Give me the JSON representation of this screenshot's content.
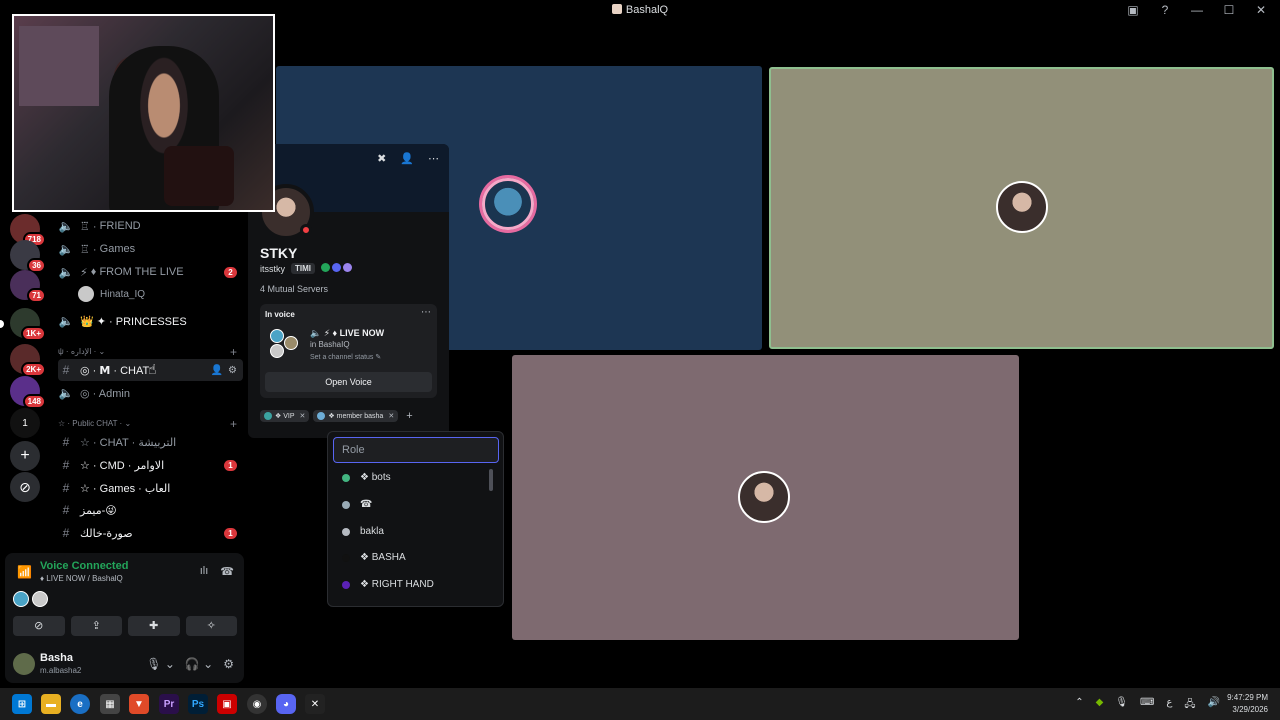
{
  "window": {
    "title": "BashalQ"
  },
  "rail": {
    "badges": [
      "718",
      "36",
      "71",
      "1K+",
      "2K+",
      "148"
    ],
    "number_item": "1",
    "add_label": "+",
    "discover_label": "⊘"
  },
  "channels": {
    "items": [
      {
        "label": "FRIEND",
        "prefix": "♖ ·"
      },
      {
        "label": "Games",
        "prefix": "♖ ·"
      },
      {
        "label": "♦ FROM THE LIVE",
        "prefix": "⚡",
        "badge": "2"
      },
      {
        "label": "✦ · PRINCESSES",
        "prefix": "👑"
      },
      {
        "label": "◎ · 𝗠 · CHAT",
        "prefix": ""
      },
      {
        "label": "◎ · Admin",
        "prefix": ""
      },
      {
        "label": "☆ · CHAT · التربيشة",
        "prefix": ""
      },
      {
        "label": "☆ · CMD · الاوامر",
        "prefix": "",
        "badge": "1"
      },
      {
        "label": "☆ · Games · العاب",
        "prefix": ""
      },
      {
        "label": "ميمز-😜",
        "prefix": ""
      },
      {
        "label": "صورة-خالك",
        "prefix": "",
        "badge": "1"
      }
    ],
    "voice_user": "Hinata_IQ",
    "category_admin": "ψ · الإداره ·",
    "category_public": "☆ · Public CHAT ·"
  },
  "voice": {
    "status": "Voice Connected",
    "channel": "♦ LIVE NOW / BashalQ"
  },
  "user": {
    "name": "Basha",
    "username": "m.albasha2"
  },
  "profile": {
    "name": "STKY",
    "handle": "itsstky",
    "tag": "TIMI",
    "mutual": "4 Mutual Servers",
    "in_voice_label": "In voice",
    "voice_channel": "♦ LIVE NOW",
    "voice_in": "in BashaIQ",
    "channel_status": "Set a channel status",
    "open_voice": "Open Voice",
    "roles": [
      {
        "name": "❖ VIP",
        "color": "#3ba2a0"
      },
      {
        "name": "❖ member basha",
        "color": "#6dadd6"
      }
    ]
  },
  "role_picker": {
    "placeholder": "Role",
    "items": [
      {
        "name": "❖ bots",
        "color": "#43b581"
      },
      {
        "name": "☎",
        "color": "#99aab5"
      },
      {
        "name": "bakla",
        "color": "#b5bac1"
      },
      {
        "name": "❖ BASHA",
        "color": "#111111"
      },
      {
        "name": "❖ RIGHT HAND",
        "color": "#5b21b6"
      }
    ]
  },
  "taskbar": {
    "time": "9:47:29 PM",
    "date": "3/29/2026",
    "lang": "ع"
  }
}
